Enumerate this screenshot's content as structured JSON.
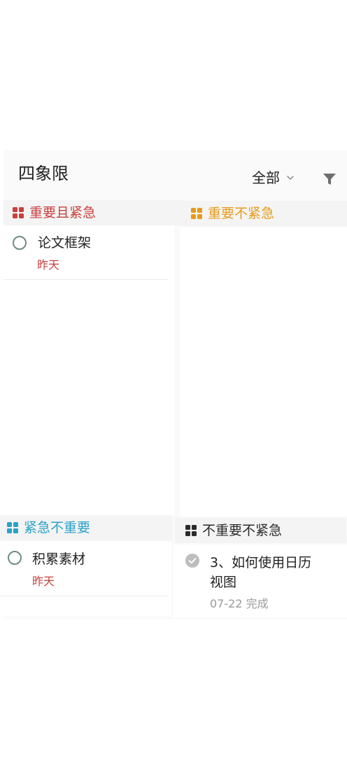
{
  "header": {
    "title": "四象限",
    "filter_label": "全部"
  },
  "colors": {
    "urgent_important": "#c8413e",
    "important_not_urgent": "#e69a1c",
    "urgent_not_important": "#2aa1c7",
    "neither": "#2b2b2b",
    "due_overdue": "#c8413e",
    "completed_text": "#9a9a9a"
  },
  "quadrants": [
    {
      "name": "重要且紧急",
      "tasks": [
        {
          "title": "论文框架",
          "date": "昨天"
        }
      ]
    },
    {
      "name": "重要不紧急",
      "tasks": []
    },
    {
      "name": "紧急不重要",
      "tasks": [
        {
          "title": "积累素材",
          "date": "昨天"
        }
      ]
    },
    {
      "name": "不重要不紧急",
      "tasks": [
        {
          "title_line1": "3、如何使用日历",
          "title_line2": "视图",
          "date": "07-22 完成"
        }
      ]
    }
  ]
}
